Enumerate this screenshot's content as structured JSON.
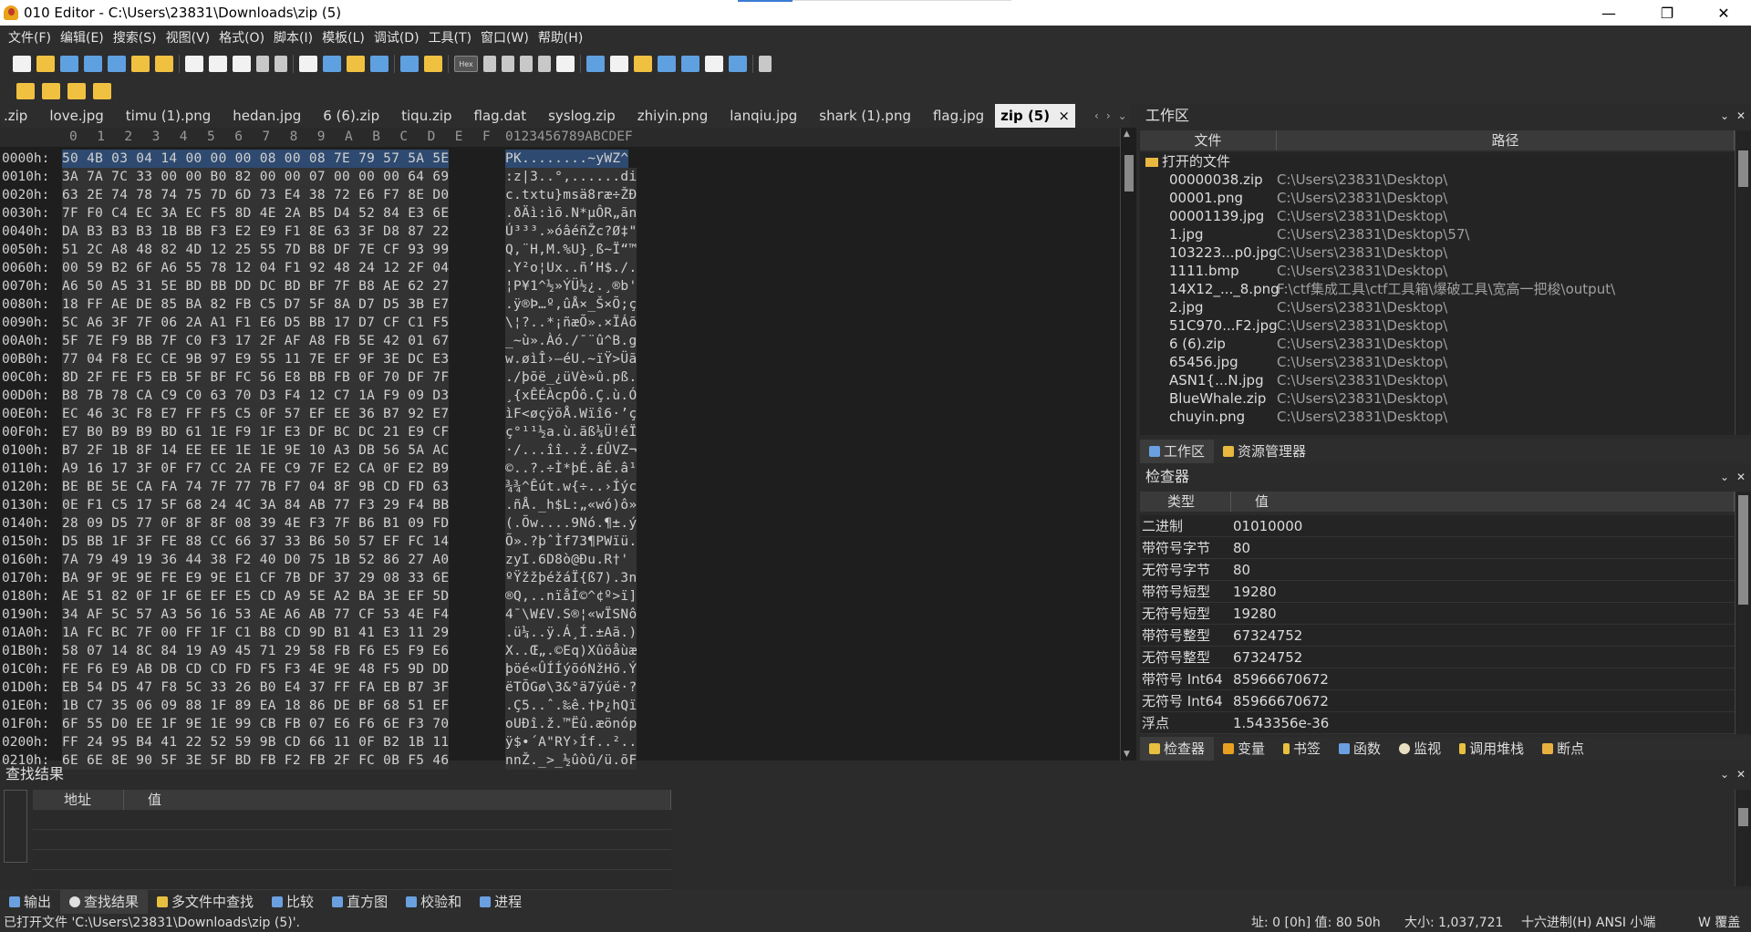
{
  "window": {
    "title": "010 Editor - C:\\Users\\23831\\Downloads\\zip (5)",
    "minimize": "—",
    "restore": "❐",
    "close": "✕"
  },
  "menu": [
    "文件(F)",
    "编辑(E)",
    "搜索(S)",
    "视图(V)",
    "格式(O)",
    "脚本(I)",
    "模板(L)",
    "调试(D)",
    "工具(T)",
    "窗口(W)",
    "帮助(H)"
  ],
  "tabs": [
    ".zip",
    "love.jpg",
    "timu (1).png",
    "hedan.jpg",
    "6 (6).zip",
    "tiqu.zip",
    "flag.dat",
    "syslog.zip",
    "zhiyin.png",
    "lanqiu.jpg",
    "shark (1).png",
    "flag.jpg",
    "zip (5)"
  ],
  "active_tab_close": "×",
  "tab_nav": [
    "‹",
    "›",
    "⌄"
  ],
  "toolbar": {
    "hex_label": "Hex"
  },
  "ruler": {
    "cols": [
      "0",
      "1",
      "2",
      "3",
      "4",
      "5",
      "6",
      "7",
      "8",
      "9",
      "A",
      "B",
      "C",
      "D",
      "E",
      "F"
    ],
    "ascii": "0123456789ABCDEF"
  },
  "hex_rows": [
    {
      "off": "0000h:",
      "hex": "50 4B 03 04 14 00 00 00 08 00 08 7E 79 57 5A 5E",
      "asc": "PK........~yWZ^"
    },
    {
      "off": "0010h:",
      "hex": "3A 7A 7C 33 00 00 B0 82 00 00 07 00 00 00 64 69",
      "asc": ":z|3..°,......di"
    },
    {
      "off": "0020h:",
      "hex": "63 2E 74 78 74 75 7D 6D 73 E4 38 72 E6 F7 8E D0",
      "asc": "c.txtu}msä8ræ÷ŽÐ"
    },
    {
      "off": "0030h:",
      "hex": "7F F0 C4 EC 3A EC F5 8D 4E 2A B5 D4 52 84 E3 6E",
      "asc": ".ðÄì:ìõ.N*µÔR„ãn"
    },
    {
      "off": "0040h:",
      "hex": "DA B3 B3 B3 1B BB F3 E2 E9 F1 8E 63 3F D8 87 22",
      "asc": "Ú³³³.»óâéñŽc?Ø‡\""
    },
    {
      "off": "0050h:",
      "hex": "51 2C A8 48 82 4D 12 25 55 7D B8 DF 7E CF 93 99",
      "asc": "Q,¨H‚M.%U}¸ß~Ï“™"
    },
    {
      "off": "0060h:",
      "hex": "00 59 B2 6F A6 55 78 12 04 F1 92 48 24 12 2F 04",
      "asc": ".Y²o¦Ux..ñ’H$./."
    },
    {
      "off": "0070h:",
      "hex": "A6 50 A5 31 5E BD BB DD DC BD BF 7F B8 AE 62 27",
      "asc": "¦P¥1^½»ÝÜ½¿.¸®b'"
    },
    {
      "off": "0080h:",
      "hex": "18 FF AE DE 85 BA 82 FB C5 D7 5F 8A D7 D5 3B E7",
      "asc": ".ÿ®Þ…º‚ûÅ×_Š×Õ;ç"
    },
    {
      "off": "0090h:",
      "hex": "5C A6 3F 7F 06 2A A1 F1 E6 D5 BB 17 D7 CF C1 F5",
      "asc": "\\¦?..*¡ñæÕ».×ÏÁõ"
    },
    {
      "off": "00A0h:",
      "hex": "5F 7E F9 BB 7F C0 F3 17 2F AF A8 FB 5E 42 01 67",
      "asc": "_~ù».Àó./¯¨û^B.g"
    },
    {
      "off": "00B0h:",
      "hex": "77 04 F8 EC CE 9B 97 E9 55 11 7E EF 9F 3E DC E3",
      "asc": "w.øìÎ›—éU.~ïŸ>Üã"
    },
    {
      "off": "00C0h:",
      "hex": "8D 2F FE F5 EB 5F BF FC 56 E8 BB FB 0F 70 DF 7F",
      "asc": "./þõë_¿üVè»û.pß."
    },
    {
      "off": "00D0h:",
      "hex": "B8 7B 78 CA C9 C0 63 70 D3 F4 12 C7 1A F9 09 D3",
      "asc": "¸{xÊÉÀcpÓô.Ç.ù.Ó"
    },
    {
      "off": "00E0h:",
      "hex": "EC 46 3C F8 E7 FF F5 C5 0F 57 EF EE 36 B7 92 E7",
      "asc": "ìF<øçÿõÅ.Wïî6·’ç"
    },
    {
      "off": "00F0h:",
      "hex": "E7 B0 B9 B9 BD 61 1E F9 1F E3 DF BC DC 21 E9 CF",
      "asc": "ç°¹¹½a.ù.ãß¼Ü!éÏ"
    },
    {
      "off": "0100h:",
      "hex": "B7 2F 1B 8F 14 EE EE 1E 1E 9E 10 A3 DB 56 5A AC",
      "asc": "·/...îî..ž.£ÛVZ¬"
    },
    {
      "off": "0110h:",
      "hex": "A9 16 17 3F 0F F7 CC 2A FE C9 7F E2 CA 0F E2 B9",
      "asc": "©..?.÷Ì*þÉ.âÊ.â¹"
    },
    {
      "off": "0120h:",
      "hex": "BE BE 5E CA FA 74 7F 77 7B F7 04 8F 9B CD FD 63",
      "asc": "¾¾^Êút.w{÷..›Íýc"
    },
    {
      "off": "0130h:",
      "hex": "0E F1 C5 17 5F 68 24 4C 3A 84 AB 77 F3 29 F4 BB",
      "asc": ".ñÅ._h$L:„«wó)ô»"
    },
    {
      "off": "0140h:",
      "hex": "28 09 D5 77 0F 8F 8F 08 39 4E F3 7F B6 B1 09 FD",
      "asc": "(.Õw....9Nó.¶±.ý"
    },
    {
      "off": "0150h:",
      "hex": "D5 BB 1F 3F FE 88 CC 66 37 33 B6 50 57 EF FC 14",
      "asc": "Õ».?þˆÌf73¶PWïü."
    },
    {
      "off": "0160h:",
      "hex": "7A 79 49 19 36 44 38 F2 40 D0 75 1B 52 86 27 A0",
      "asc": "zyI.6D8ò@Ðu.R†' "
    },
    {
      "off": "0170h:",
      "hex": "BA 9F 9E 9E FE E9 9E E1 CF 7B DF 37 29 08 33 6E",
      "asc": "ºŸžžþéžáÏ{ß7).3n"
    },
    {
      "off": "0180h:",
      "hex": "AE 51 82 0F 1F 6E EF E5 CD A9 5E A2 BA 3E EF 5D",
      "asc": "®Q‚..nïåÍ©^¢º>ï]"
    },
    {
      "off": "0190h:",
      "hex": "34 AF 5C 57 A3 56 16 53 AE A6 AB 77 CF 53 4E F4",
      "asc": "4¯\\W£V.S®¦«wÏSNô"
    },
    {
      "off": "01A0h:",
      "hex": "1A FC BC 7F 00 FF 1F C1 B8 CD 9D B1 41 E3 11 29",
      "asc": ".ü¼..ÿ.Á¸Í.±Aã.)"
    },
    {
      "off": "01B0h:",
      "hex": "58 07 14 8C 84 19 A9 45 71 29 58 FB F6 E5 F9 E6",
      "asc": "X..Œ„.©Eq)Xûöåùæ"
    },
    {
      "off": "01C0h:",
      "hex": "FE F6 E9 AB DB CD CD FD F5 F3 4E 9E 48 F5 9D DD",
      "asc": "þöé«ÛÍÍýõóNžHõ.Ý"
    },
    {
      "off": "01D0h:",
      "hex": "EB 54 D5 47 F8 5C 33 26 B0 E4 37 FF FA EB B7 3F",
      "asc": "ëTÕGø\\3&°ä7ÿúë·?"
    },
    {
      "off": "01E0h:",
      "hex": "1B C7 35 06 09 88 1F 89 EA 18 86 DE BF 68 51 EF",
      "asc": ".Ç5..ˆ.‰ê.†Þ¿hQï"
    },
    {
      "off": "01F0h:",
      "hex": "6F 55 D0 EE 1F 9E 1E 99 CB FB 07 E6 F6 6E F3 70",
      "asc": "oUÐî.ž.™Ëû.æönóp"
    },
    {
      "off": "0200h:",
      "hex": "FF 24 95 B4 41 22 52 59 9B CD 66 11 0F B2 1B 11",
      "asc": "ÿ$•´A\"RY›Íf..².."
    },
    {
      "off": "0210h:",
      "hex": "6E 6E 8E 90 5F 3E 5F BD FB F2 FB 2F FC 0B F5 46",
      "asc": "nnŽ._>_½ûòû/ü.õF"
    }
  ],
  "workspace": {
    "title": "工作区",
    "controls": [
      "⌄",
      "✕"
    ],
    "col_file": "文件",
    "col_path": "路径",
    "group": "打开的文件",
    "files": [
      {
        "name": "00000038.zip",
        "path": "C:\\Users\\23831\\Desktop\\"
      },
      {
        "name": "00001.png",
        "path": "C:\\Users\\23831\\Desktop\\"
      },
      {
        "name": "00001139.jpg",
        "path": "C:\\Users\\23831\\Desktop\\"
      },
      {
        "name": "1.jpg",
        "path": "C:\\Users\\23831\\Desktop\\57\\"
      },
      {
        "name": "103223...p0.jpg",
        "path": "C:\\Users\\23831\\Desktop\\"
      },
      {
        "name": "1111.bmp",
        "path": "C:\\Users\\23831\\Desktop\\"
      },
      {
        "name": "14X12_..._8.png",
        "path": "F:\\ctf集成工具\\ctf工具箱\\爆破工具\\宽高一把梭\\output\\"
      },
      {
        "name": "2.jpg",
        "path": "C:\\Users\\23831\\Desktop\\"
      },
      {
        "name": "51C970...F2.jpg",
        "path": "C:\\Users\\23831\\Desktop\\"
      },
      {
        "name": "6 (6).zip",
        "path": "C:\\Users\\23831\\Desktop\\"
      },
      {
        "name": "65456.jpg",
        "path": "C:\\Users\\23831\\Desktop\\"
      },
      {
        "name": "ASN1{...N.jpg",
        "path": "C:\\Users\\23831\\Desktop\\"
      },
      {
        "name": "BlueWhale.zip",
        "path": "C:\\Users\\23831\\Desktop\\"
      },
      {
        "name": "chuyin.png",
        "path": "C:\\Users\\23831\\Desktop\\"
      }
    ],
    "tabs": [
      "工作区",
      "资源管理器"
    ]
  },
  "inspector": {
    "title": "检查器",
    "controls": [
      "⌄",
      "✕"
    ],
    "col_type": "类型",
    "col_value": "值",
    "rows": [
      {
        "t": "二进制",
        "v": "01010000"
      },
      {
        "t": "带符号字节",
        "v": "80"
      },
      {
        "t": "无符号字节",
        "v": "80"
      },
      {
        "t": "带符号短型",
        "v": "19280"
      },
      {
        "t": "无符号短型",
        "v": "19280"
      },
      {
        "t": "带符号整型",
        "v": "67324752"
      },
      {
        "t": "无符号整型",
        "v": "67324752"
      },
      {
        "t": "带符号 Int64",
        "v": "85966670672"
      },
      {
        "t": "无符号 Int64",
        "v": "85966670672"
      },
      {
        "t": "浮点",
        "v": "1.543356e-36"
      }
    ],
    "tabs": [
      "检查器",
      "变量",
      "书签",
      "函数",
      "监视",
      "调用堆栈",
      "断点"
    ]
  },
  "find": {
    "title": "查找结果",
    "controls": [
      "⌄",
      "✕"
    ],
    "col_addr": "地址",
    "col_value": "值"
  },
  "bottom_tabs": [
    "输出",
    "查找结果",
    "多文件中查找",
    "比较",
    "直方图",
    "校验和",
    "进程"
  ],
  "status": {
    "left": "已打开文件 'C:\\Users\\23831\\Downloads\\zip (5)'.",
    "pos": "址: 0 [0h]  值: 80 50h",
    "size": "大小: 1,037,721",
    "encoding": "十六进制(H)  ANSI  小端",
    "mode": "W  覆盖"
  }
}
